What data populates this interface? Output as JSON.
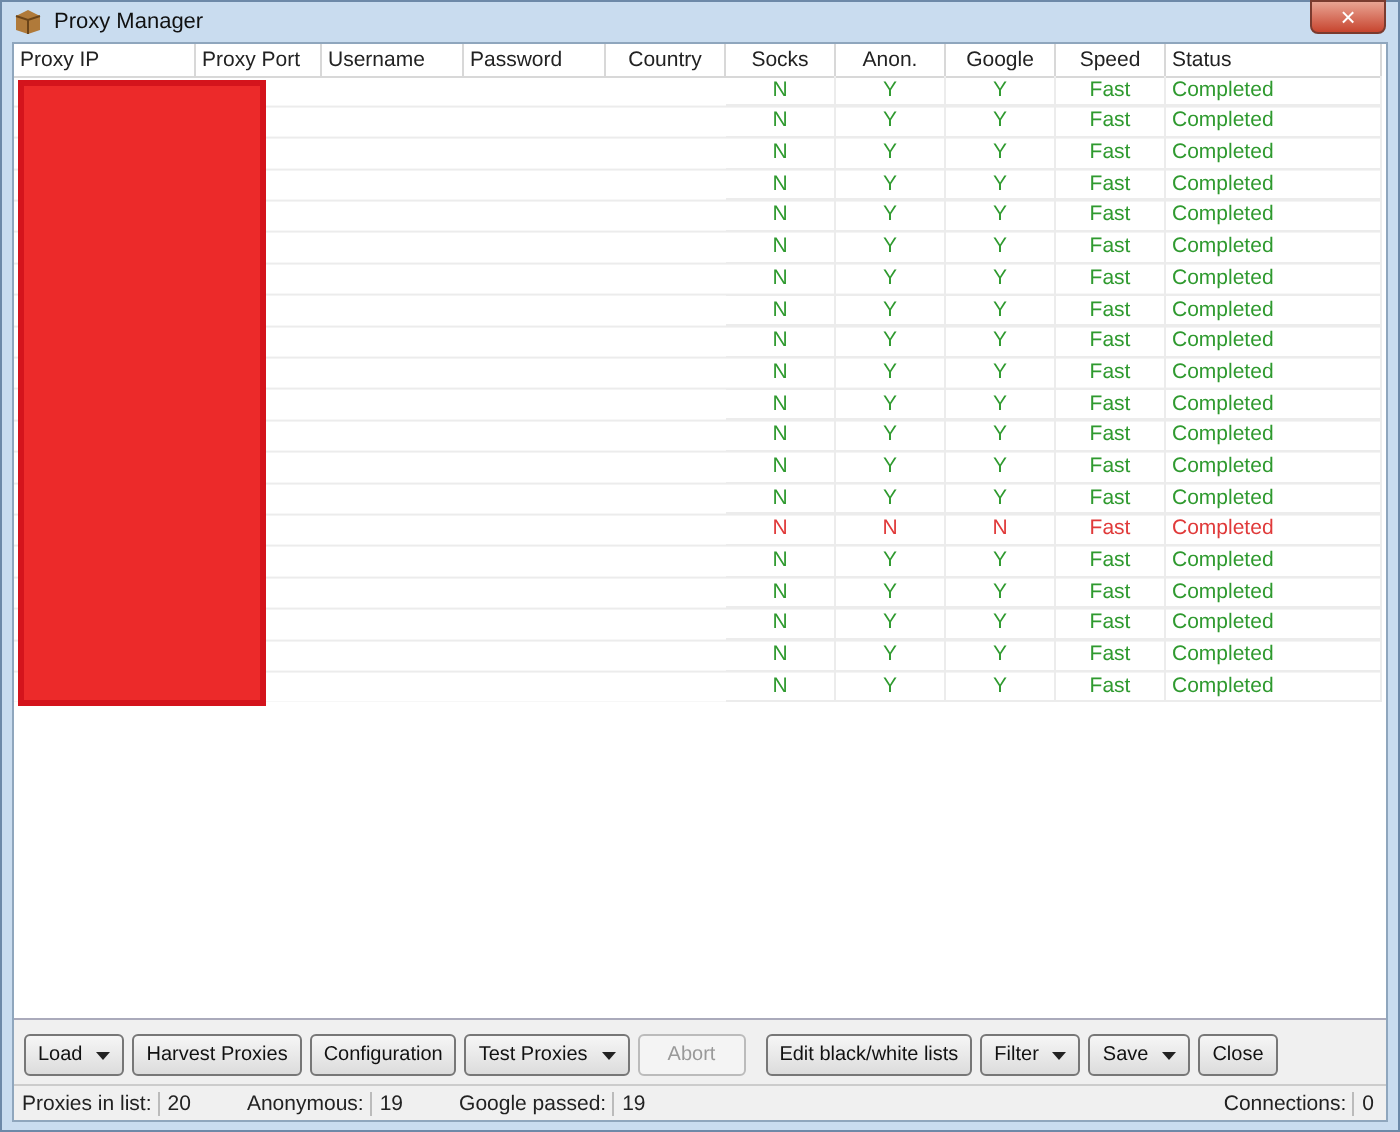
{
  "window": {
    "title": "Proxy Manager",
    "close": "×"
  },
  "table": {
    "columns": [
      "Proxy IP",
      "Proxy Port",
      "Username",
      "Password",
      "Country",
      "Socks",
      "Anon.",
      "Google",
      "Speed",
      "Status"
    ],
    "rows": [
      {
        "socks": "N",
        "anon": "Y",
        "google": "Y",
        "speed": "Fast",
        "status": "Completed",
        "color": "#2f9a2f"
      },
      {
        "socks": "N",
        "anon": "Y",
        "google": "Y",
        "speed": "Fast",
        "status": "Completed",
        "color": "#2f9a2f"
      },
      {
        "socks": "N",
        "anon": "Y",
        "google": "Y",
        "speed": "Fast",
        "status": "Completed",
        "color": "#2f9a2f"
      },
      {
        "socks": "N",
        "anon": "Y",
        "google": "Y",
        "speed": "Fast",
        "status": "Completed",
        "color": "#2f9a2f"
      },
      {
        "socks": "N",
        "anon": "Y",
        "google": "Y",
        "speed": "Fast",
        "status": "Completed",
        "color": "#2f9a2f"
      },
      {
        "socks": "N",
        "anon": "Y",
        "google": "Y",
        "speed": "Fast",
        "status": "Completed",
        "color": "#2f9a2f"
      },
      {
        "socks": "N",
        "anon": "Y",
        "google": "Y",
        "speed": "Fast",
        "status": "Completed",
        "color": "#2f9a2f"
      },
      {
        "socks": "N",
        "anon": "Y",
        "google": "Y",
        "speed": "Fast",
        "status": "Completed",
        "color": "#2f9a2f"
      },
      {
        "socks": "N",
        "anon": "Y",
        "google": "Y",
        "speed": "Fast",
        "status": "Completed",
        "color": "#2f9a2f"
      },
      {
        "socks": "N",
        "anon": "Y",
        "google": "Y",
        "speed": "Fast",
        "status": "Completed",
        "color": "#2f9a2f"
      },
      {
        "socks": "N",
        "anon": "Y",
        "google": "Y",
        "speed": "Fast",
        "status": "Completed",
        "color": "#2f9a2f"
      },
      {
        "socks": "N",
        "anon": "Y",
        "google": "Y",
        "speed": "Fast",
        "status": "Completed",
        "color": "#2f9a2f"
      },
      {
        "socks": "N",
        "anon": "Y",
        "google": "Y",
        "speed": "Fast",
        "status": "Completed",
        "color": "#2f9a2f"
      },
      {
        "socks": "N",
        "anon": "Y",
        "google": "Y",
        "speed": "Fast",
        "status": "Completed",
        "color": "#2f9a2f"
      },
      {
        "socks": "N",
        "anon": "N",
        "google": "N",
        "speed": "Fast",
        "status": "Completed",
        "color": "#e03a3a"
      },
      {
        "socks": "N",
        "anon": "Y",
        "google": "Y",
        "speed": "Fast",
        "status": "Completed",
        "color": "#2f9a2f"
      },
      {
        "socks": "N",
        "anon": "Y",
        "google": "Y",
        "speed": "Fast",
        "status": "Completed",
        "color": "#2f9a2f"
      },
      {
        "socks": "N",
        "anon": "Y",
        "google": "Y",
        "speed": "Fast",
        "status": "Completed",
        "color": "#2f9a2f"
      },
      {
        "socks": "N",
        "anon": "Y",
        "google": "Y",
        "speed": "Fast",
        "status": "Completed",
        "color": "#2f9a2f"
      },
      {
        "socks": "N",
        "anon": "Y",
        "google": "Y",
        "speed": "Fast",
        "status": "Completed",
        "color": "#2f9a2f"
      }
    ]
  },
  "buttons": [
    {
      "label": "Load",
      "kind": "dropdown",
      "disabled": false
    },
    {
      "label": "Harvest Proxies",
      "kind": "plain",
      "disabled": false
    },
    {
      "label": "Configuration",
      "kind": "plain",
      "disabled": false
    },
    {
      "label": "Test Proxies",
      "kind": "dropdown",
      "disabled": false
    },
    {
      "label": "Abort",
      "kind": "plain",
      "disabled": true
    },
    {
      "label": "Edit black/white lists",
      "kind": "plain",
      "disabled": false
    },
    {
      "label": "Filter",
      "kind": "dropdown",
      "disabled": false
    },
    {
      "label": "Save",
      "kind": "dropdown",
      "disabled": false
    },
    {
      "label": "Close",
      "kind": "plain",
      "disabled": false
    }
  ],
  "status_bar": [
    {
      "label": "Proxies in list:",
      "value": "20"
    },
    {
      "label": "Anonymous:",
      "value": "19"
    },
    {
      "label": "Google passed:",
      "value": "19"
    },
    {
      "label": "Connections:",
      "value": "0"
    }
  ]
}
